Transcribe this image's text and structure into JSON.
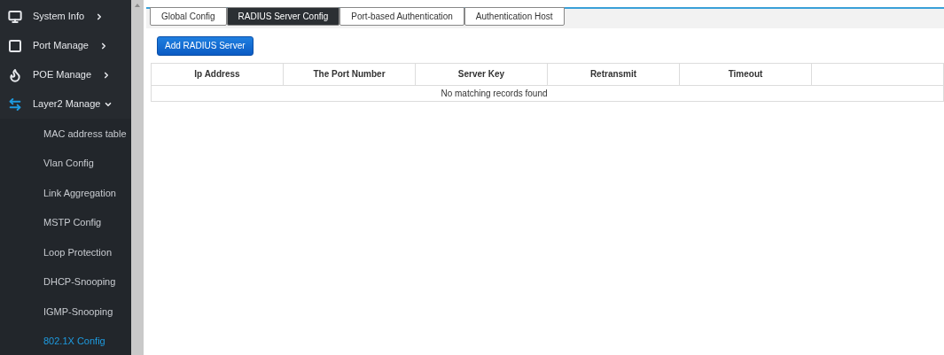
{
  "sidebar": {
    "items": [
      {
        "label": "System Info",
        "expanded": false,
        "selected": false
      },
      {
        "label": "Port Manage",
        "expanded": false,
        "selected": false
      },
      {
        "label": "POE Manage",
        "expanded": false,
        "selected": false
      },
      {
        "label": "Layer2 Manage",
        "expanded": true,
        "selected": true,
        "children": [
          {
            "label": "MAC address table",
            "selected": false
          },
          {
            "label": "Vlan Config",
            "selected": false
          },
          {
            "label": "Link Aggregation",
            "selected": false
          },
          {
            "label": "MSTP Config",
            "selected": false
          },
          {
            "label": "Loop Protection",
            "selected": false
          },
          {
            "label": "DHCP-Snooping",
            "selected": false
          },
          {
            "label": "IGMP-Snooping",
            "selected": false
          },
          {
            "label": "802.1X Config",
            "selected": true
          }
        ]
      }
    ]
  },
  "tabs": [
    {
      "label": "Global Config",
      "selected": false
    },
    {
      "label": "RADIUS Server Config",
      "selected": true
    },
    {
      "label": "Port-based Authentication",
      "selected": false
    },
    {
      "label": "Authentication Host",
      "selected": false
    }
  ],
  "add_button": "Add RADIUS Server",
  "table": {
    "columns": [
      "Ip Address",
      "The Port Number",
      "Server Key",
      "Retransmit",
      "Timeout"
    ],
    "empty_message": "No matching records found"
  }
}
